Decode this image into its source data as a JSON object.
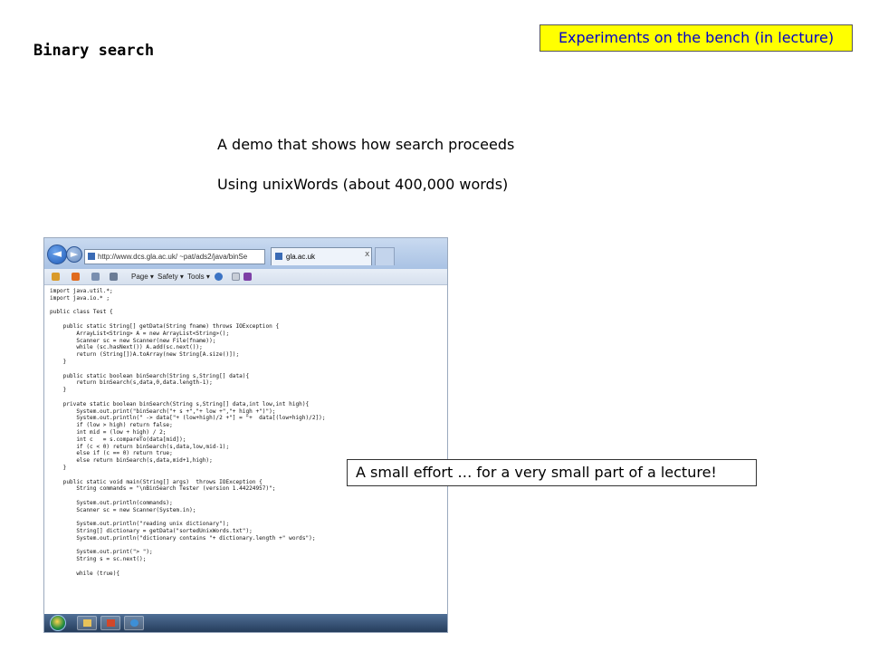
{
  "slide": {
    "title": "Binary search",
    "banner": "Experiments on the bench (in lecture)",
    "line1": "A demo that shows how search proceeds",
    "line2": "Using unixWords (about 400,000 words)",
    "callout": "A small effort … for a very small part of a lecture!"
  },
  "browser": {
    "address": "http://www.dcs.gla.ac.uk/ ~pat/ads2/java/binSe",
    "tab_title": "gla.ac.uk",
    "tab_close": "x",
    "toolbar": {
      "page": "Page ▾",
      "safety": "Safety ▾",
      "tools": "Tools ▾"
    },
    "code": "import java.util.*;\nimport java.io.* ;\n\npublic class Test {\n\n    public static String[] getData(String fname) throws IOException {\n        ArrayList<String> A = new ArrayList<String>();\n        Scanner sc = new Scanner(new File(fname));\n        while (sc.hasNext()) A.add(sc.next());\n        return (String[])A.toArray(new String[A.size()]);\n    }\n\n    public static boolean binSearch(String s,String[] data){\n        return binSearch(s,data,0,data.length-1);\n    }\n\n    private static boolean binSearch(String s,String[] data,int low,int high){\n        System.out.print(\"binSearch(\"+ s +\",\"+ low +\",\"+ high +\")\");\n        System.out.println(\" -> data[\"+ (low+high)/2 +\"] = \"+  data[(low+high)/2]);\n        if (low > high) return false;\n        int mid = (low + high) / 2;\n        int c   = s.compareTo(data[mid]);\n        if (c < 0) return binSearch(s,data,low,mid-1);\n        else if (c == 0) return true;\n        else return binSearch(s,data,mid+1,high);\n    }\n\n    public static void main(String[] args)  throws IOException {\n        String commands = \"\\nBinSearch Tester (version 1.44224957)\";\n\n        System.out.println(commands);\n        Scanner sc = new Scanner(System.in);\n\n        System.out.println(\"reading unix dictionary\");\n        String[] dictionary = getData(\"sortedUnixWords.txt\");\n        System.out.println(\"dictionary contains \"+ dictionary.length +\" words\");\n\n        System.out.print(\"> \");\n        String s = sc.next();\n\n        while (true){"
  },
  "icons": {
    "back": "◄",
    "forward": "►"
  }
}
